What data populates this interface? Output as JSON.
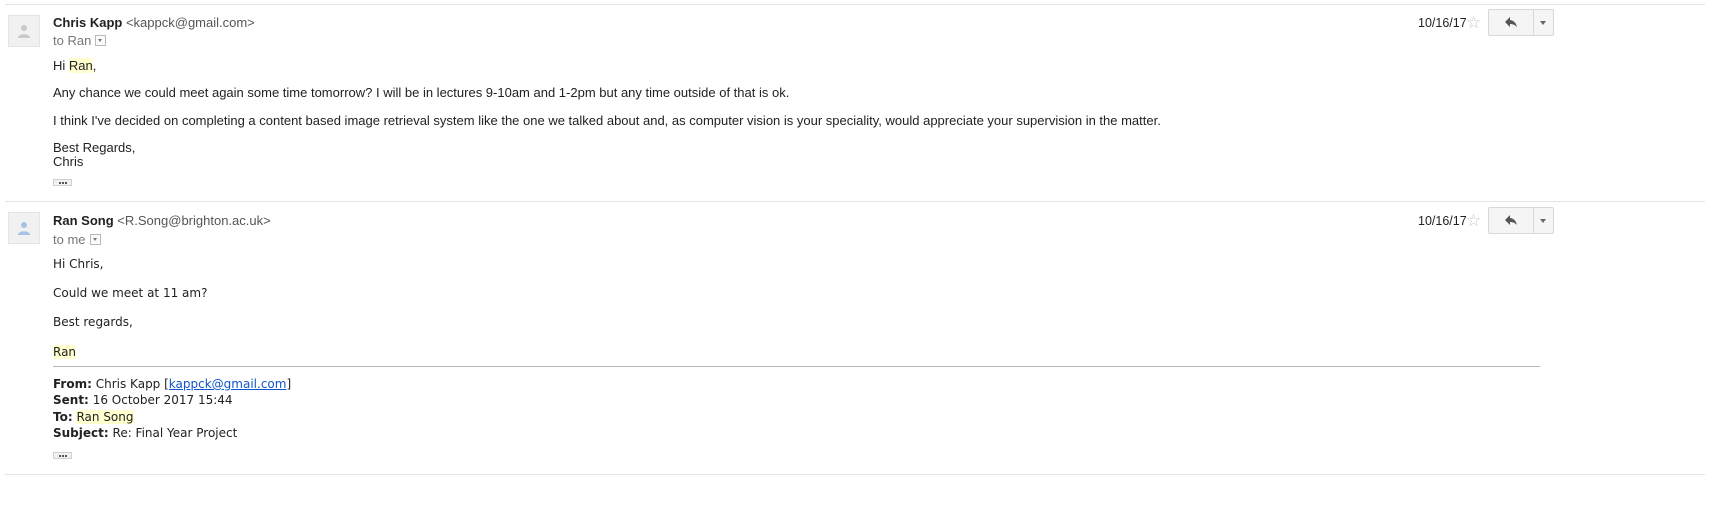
{
  "messages": [
    {
      "sender_name": "Chris Kapp",
      "sender_email": "<kappck@gmail.com>",
      "to_label": "to Ran",
      "date": "10/16/17",
      "body": {
        "greeting_prefix": "Hi ",
        "greeting_name": "Ran",
        "greeting_suffix": ",",
        "para1": "Any chance we could meet again some time tomorrow? I will be in lectures 9-10am and 1-2pm but any time outside of that is ok.",
        "para2": "I think I've decided on completing a content based image retrieval system like the one we talked about and, as computer vision is your speciality, would appreciate your supervision in the matter.",
        "signoff": "Best Regards,",
        "signature": "Chris"
      }
    },
    {
      "sender_name": "Ran Song",
      "sender_email": "<R.Song@brighton.ac.uk>",
      "to_label": "to me",
      "date": "10/16/17",
      "body": {
        "greeting": "Hi Chris,",
        "para1": "Could we meet at 11 am?",
        "signoff": "Best regards,",
        "signature": "Ran"
      },
      "quoted": {
        "from_label": "From:",
        "from_name": "Chris Kapp [",
        "from_email": "kappck@gmail.com",
        "from_close": "]",
        "sent_label": "Sent:",
        "sent_value": "16 October 2017 15:44",
        "to_label": "To:",
        "to_value": "Ran Song",
        "subject_label": "Subject:",
        "subject_value": "Re: Final Year Project"
      }
    }
  ],
  "icons": {
    "avatar": "person-silhouette-icon",
    "star": "star-outline-icon",
    "reply": "reply-arrow-icon",
    "more": "caret-down-icon",
    "show_trimmed": "ellipsis-icon"
  },
  "colors": {
    "highlight": "#ffffd0",
    "link": "#1155cc",
    "star": "#c8c8c8"
  }
}
